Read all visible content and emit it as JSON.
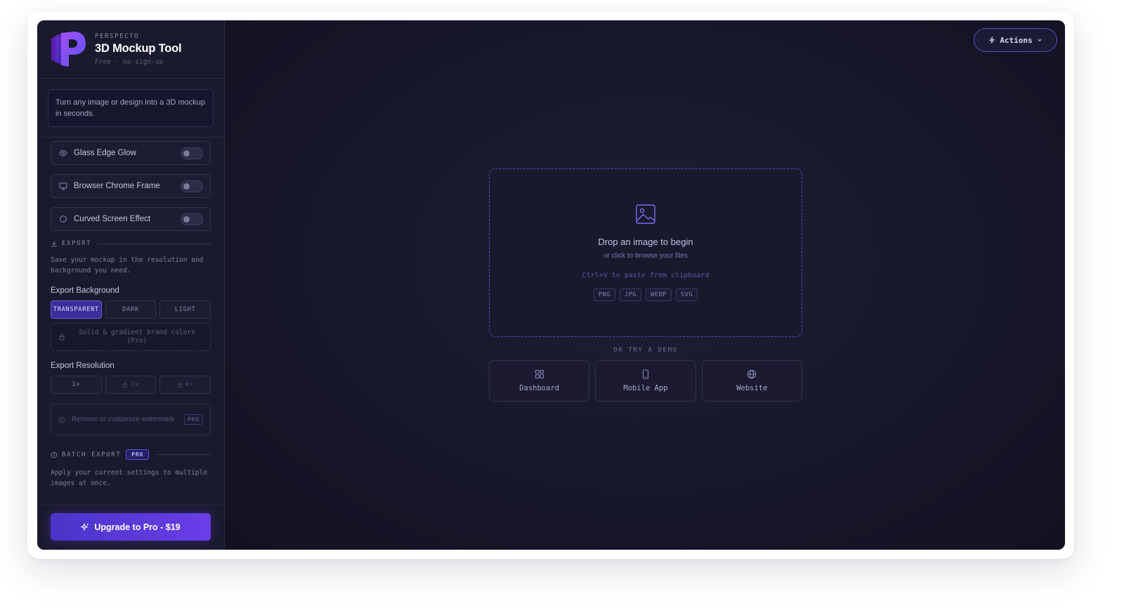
{
  "brand": {
    "kicker": "PERSPECTO",
    "title": "3D Mockup Tool",
    "subtitle": "Free · no sign-up"
  },
  "intro": "Turn any image or design into a 3D mockup in seconds.",
  "toggles": [
    {
      "label": "Glass Edge Glow",
      "icon": "eye-icon",
      "on": false
    },
    {
      "label": "Browser Chrome Frame",
      "icon": "monitor-icon",
      "on": false
    },
    {
      "label": "Curved Screen Effect",
      "icon": "circle-icon",
      "on": false
    }
  ],
  "export": {
    "heading": "EXPORT",
    "description": "Save your mockup in the resolution and background you need.",
    "background_label": "Export Background",
    "background_options": [
      "TRANSPARENT",
      "DARK",
      "LIGHT"
    ],
    "background_selected": "TRANSPARENT",
    "pro_colors": "Solid & gradient brand colors (Pro)",
    "resolution_label": "Export Resolution",
    "resolution_options": [
      "1×",
      "2×",
      "4×"
    ],
    "resolution_selected": "1×",
    "watermark": "Remove or customize watermark",
    "watermark_badge": "PRO"
  },
  "batch": {
    "heading": "BATCH EXPORT",
    "badge": "PRO",
    "description": "Apply your current settings to multiple images at once."
  },
  "upgrade_label": "Upgrade to Pro - $19",
  "actions_label": "Actions",
  "dropzone": {
    "title": "Drop an image to begin",
    "subtitle": "or click to browse your files",
    "paste_hint": "Ctrl+V to paste from clipboard",
    "formats": [
      "PNG",
      "JPG",
      "WEBP",
      "SVG"
    ]
  },
  "demo_label": "OR TRY A DEMO",
  "demos": [
    {
      "label": "Dashboard",
      "icon": "grid-icon"
    },
    {
      "label": "Mobile App",
      "icon": "phone-icon"
    },
    {
      "label": "Website",
      "icon": "globe-icon"
    }
  ],
  "colors": {
    "accent": "#6a3ee8",
    "app_bg": "#16162a",
    "sidebar_bg": "#1a1a2e"
  }
}
